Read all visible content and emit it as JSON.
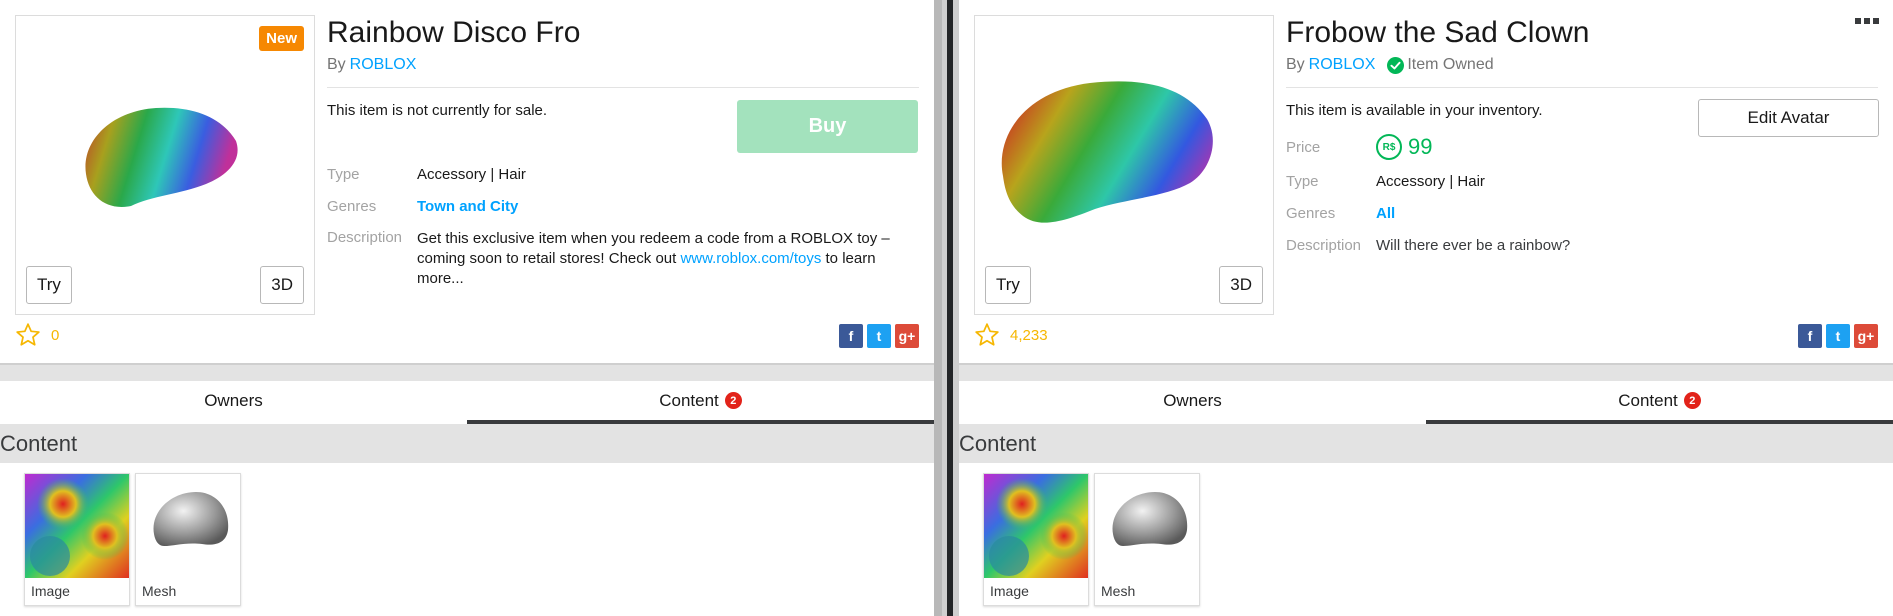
{
  "left": {
    "badge": "New",
    "try_label": "Try",
    "view3d_label": "3D",
    "title": "Rainbow Disco Fro",
    "by_prefix": "By",
    "creator": "ROBLOX",
    "status": "This item is not currently for sale.",
    "buy_label": "Buy",
    "type_label": "Type",
    "type_value": "Accessory | Hair",
    "genres_label": "Genres",
    "genres_value": "Town and City",
    "description_label": "Description",
    "description_pre": "Get this exclusive item when you redeem a code from a ROBLOX toy – coming soon to retail stores! Check out ",
    "description_link": "www.roblox.com/toys",
    "description_post": " to learn more...",
    "favorites": "0",
    "tabs": [
      {
        "label": "Owners"
      },
      {
        "label": "Content",
        "count": "2"
      }
    ],
    "content_heading": "Content",
    "content_items": [
      {
        "label": "Image"
      },
      {
        "label": "Mesh"
      }
    ]
  },
  "right": {
    "try_label": "Try",
    "view3d_label": "3D",
    "title": "Frobow the Sad Clown",
    "by_prefix": "By",
    "creator": "ROBLOX",
    "owned_label": "Item Owned",
    "status": "This item is available in your inventory.",
    "edit_label": "Edit Avatar",
    "price_label": "Price",
    "currency_symbol": "R$",
    "price_value": "99",
    "type_label": "Type",
    "type_value": "Accessory | Hair",
    "genres_label": "Genres",
    "genres_value": "All",
    "description_label": "Description",
    "description_value": "Will there ever be a rainbow?",
    "favorites": "4,233",
    "tabs": [
      {
        "label": "Owners"
      },
      {
        "label": "Content",
        "count": "2"
      }
    ],
    "content_heading": "Content",
    "content_items": [
      {
        "label": "Image"
      },
      {
        "label": "Mesh"
      }
    ]
  },
  "social": {
    "facebook": "f",
    "twitter": "t",
    "googleplus": "g+"
  },
  "icons": {
    "star": "star-icon",
    "check": "check-circle-icon",
    "robux": "robux-icon",
    "menu": "more-icon"
  },
  "colors": {
    "link": "#00a2ff",
    "badge_new": "#f68802",
    "buy_disabled": "#a3e2bd",
    "price": "#02b757",
    "star": "#f6b702",
    "tab_count": "#e2231a"
  }
}
